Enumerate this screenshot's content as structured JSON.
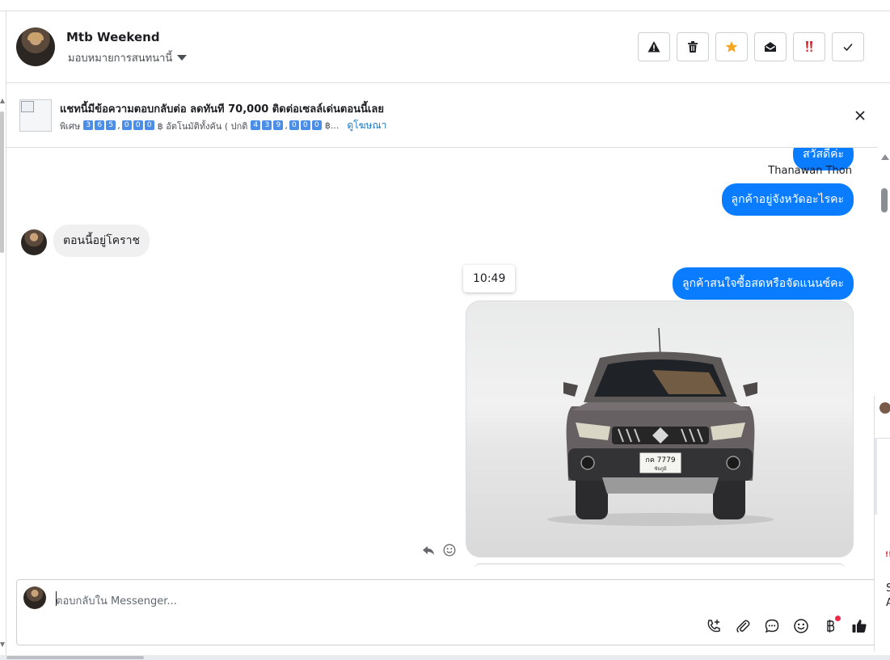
{
  "header": {
    "name": "Mtb Weekend",
    "assign": "มอบหมายการสนทนานี้"
  },
  "header_actions": [
    "spam-warning-icon",
    "trash-icon",
    "star-icon",
    "mark-unread-icon",
    "priority-icon",
    "done-check-icon"
  ],
  "ad": {
    "title": "แชทนี้มีข้อความตอบกลับต่อ ลดทันที 70,000 ติดต่อเซลล์เด่นตอนนี้เลย",
    "promo_prefix": "พิเศษ",
    "promo_price_digits": [
      "3",
      "6",
      "5",
      ",",
      "0",
      "0",
      "0"
    ],
    "promo_middle": "฿ อัตโนมัติทั้งคัน ( ปกติ",
    "promo_old_digits": [
      "4",
      "3",
      "9",
      ",",
      "0",
      "0",
      "0"
    ],
    "promo_suffix": "฿...",
    "link": "ดูโฆษณา"
  },
  "messages": {
    "out_1": "สวัสดีค่ะ",
    "sender": "Thanawan Thon",
    "out_2": "ลูกค้าอยู่จังหวัดอะไรคะ",
    "in_1": "ตอนนี้อยู่โคราช",
    "timestamp": "10:49",
    "out_3": "ลูกค้าสนใจซื้อสดหรือจัดแนนซ์คะ",
    "plate_line1": "กค 7779",
    "plate_line2": "ชัยภูมิ"
  },
  "composer": {
    "placeholder": "ตอบกลับใน Messenger..."
  },
  "composer_tools": [
    "call-add-icon",
    "attachment-icon",
    "saved-reply-icon",
    "emoji-icon",
    "payment-baht-icon",
    "thumbs-up-icon"
  ],
  "peek": {
    "line1": "S",
    "line2": "A"
  },
  "colors": {
    "accent": "#0a7cff",
    "link": "#1877c2",
    "incoming": "#f0f0f0",
    "star": "#f5a623",
    "priority": "#d3232a"
  }
}
